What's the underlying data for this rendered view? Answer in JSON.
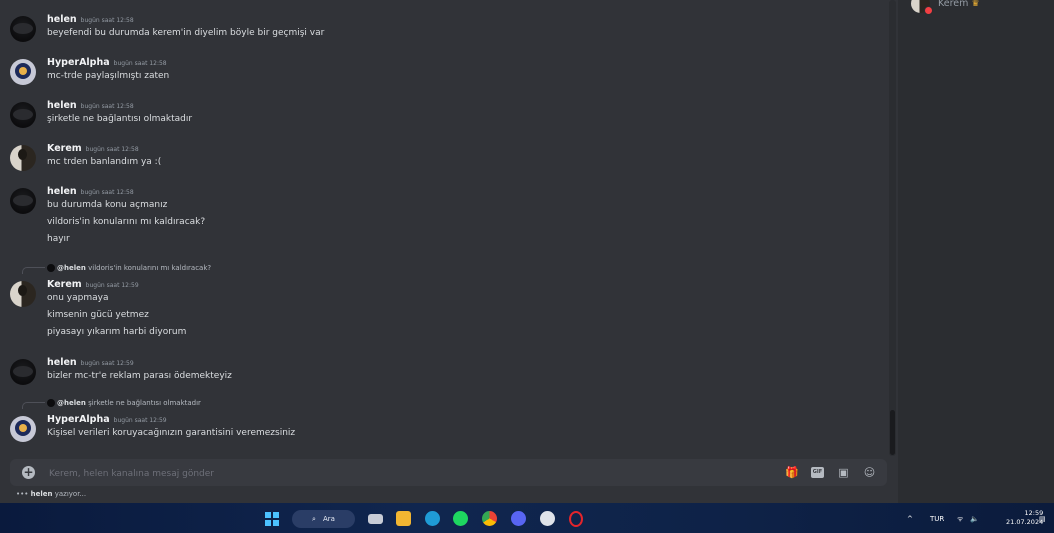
{
  "messages": [
    {
      "author": "helen",
      "time": "bugün saat 12:58",
      "avatar": "helen",
      "lines": [
        "beyefendi bu durumda kerem'in diyelim böyle bir geçmişi var"
      ]
    },
    {
      "author": "HyperAlpha",
      "time": "bugün saat 12:58",
      "avatar": "hyper",
      "lines": [
        "mc-trde paylaşılmıştı zaten"
      ]
    },
    {
      "author": "helen",
      "time": "bugün saat 12:58",
      "avatar": "helen",
      "lines": [
        "şirketle ne bağlantısı olmaktadır"
      ]
    },
    {
      "author": "Kerem",
      "time": "bugün saat 12:58",
      "avatar": "kerem",
      "lines": [
        "mc trden banlandım ya :("
      ]
    },
    {
      "author": "helen",
      "time": "bugün saat 12:58",
      "avatar": "helen",
      "lines": [
        "bu durumda konu açmanız",
        "vildoris'in konularını mı kaldıracak?",
        "hayır"
      ]
    },
    {
      "reply": {
        "author": "@helen",
        "text": "vildoris'in konularını mı kaldıracak?"
      },
      "author": "Kerem",
      "time": "bugün saat 12:59",
      "avatar": "kerem",
      "lines": [
        "onu yapmaya",
        "kimsenin gücü yetmez",
        "piyasayı yıkarım harbi diyorum"
      ]
    },
    {
      "author": "helen",
      "time": "bugün saat 12:59",
      "avatar": "helen",
      "lines": [
        "bizler mc-tr'e reklam parası ödemekteyiz"
      ]
    },
    {
      "reply": {
        "author": "@helen",
        "text": "şirketle ne bağlantısı olmaktadır"
      },
      "author": "HyperAlpha",
      "time": "bugün saat 12:59",
      "avatar": "hyper",
      "lines": [
        "Kişisel verileri koruyacağınızın garantisini veremezsiniz"
      ]
    }
  ],
  "composer": {
    "placeholder": "Kerem, helen kanalına mesaj gönder",
    "plus": "+",
    "gif": "GIF"
  },
  "typing": {
    "user": "helen",
    "text": " yazıyor..."
  },
  "sidebar": {
    "member": "Kerem",
    "crown": "♛"
  },
  "taskbar": {
    "search_label": "Ara",
    "search_icon": "⌕",
    "tray_chevron": "^",
    "language": "TUR",
    "wifi": "ᯤ",
    "volume": "🔈",
    "time": "12:59",
    "date": "21.07.2024"
  }
}
